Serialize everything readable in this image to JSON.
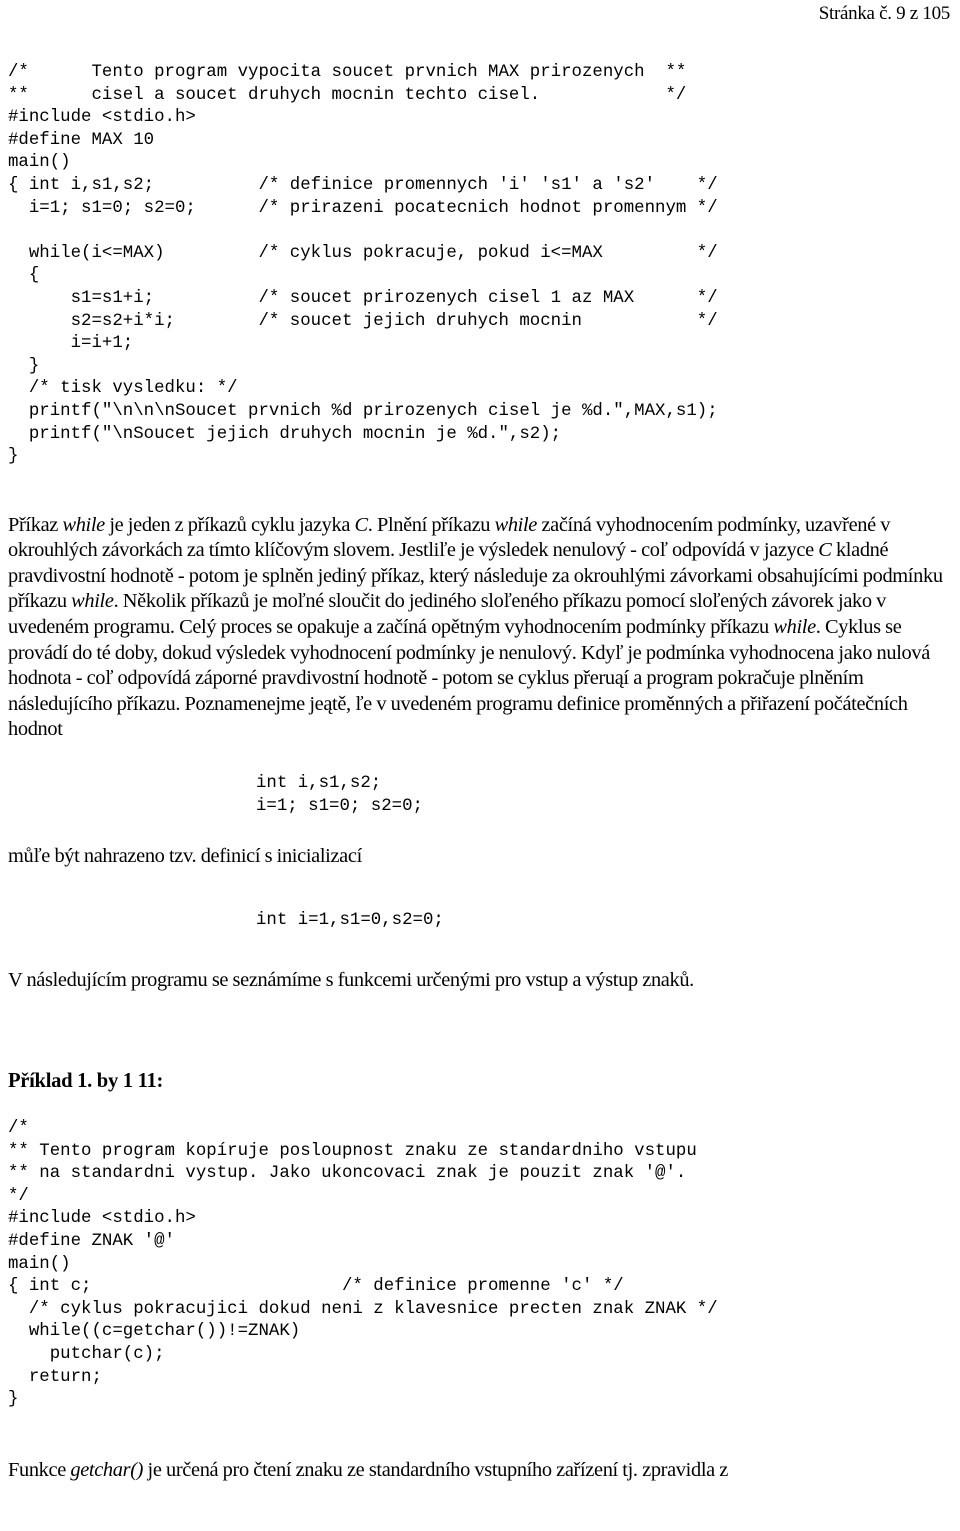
{
  "header": {
    "page_indicator": "Stránka č. 9 z 105"
  },
  "code_block_1": "/*      Tento program vypocita soucet prvnich MAX prirozenych  **\n**      cisel a soucet druhych mocnin techto cisel.            */\n#include <stdio.h>\n#define MAX 10\nmain()\n{ int i,s1,s2;          /* definice promennych 'i' 's1' a 's2'    */\n  i=1; s1=0; s2=0;      /* prirazeni pocatecnich hodnot promennym */\n\n  while(i<=MAX)         /* cyklus pokracuje, pokud i<=MAX         */\n  {\n      s1=s1+i;          /* soucet prirozenych cisel 1 az MAX      */\n      s2=s2+i*i;        /* soucet jejich druhych mocnin           */\n      i=i+1;\n  }\n  /* tisk vysledku: */\n  printf(\"\\n\\n\\nSoucet prvnich %d prirozenych cisel je %d.\",MAX,s1);\n  printf(\"\\nSoucet jejich druhych mocnin je %d.\",s2);\n}",
  "paragraph_1": {
    "parts": [
      {
        "text": "Příkaz ",
        "italic": false
      },
      {
        "text": "while",
        "italic": true
      },
      {
        "text": " je jeden z příkazů cyklu jazyka ",
        "italic": false
      },
      {
        "text": "C",
        "italic": true
      },
      {
        "text": ". Plnění příkazu ",
        "italic": false
      },
      {
        "text": "while",
        "italic": true
      },
      {
        "text": " začíná vyhodnocením podmínky, uzavřené v okrouhlých závorkách za tímto klíčovým slovem. Jestliľe je výsledek nenulový - coľ odpovídá v jazyce ",
        "italic": false
      },
      {
        "text": "C",
        "italic": true
      },
      {
        "text": " kladné pravdivostní hodnotě - potom je splněn jediný příkaz, který následuje za okrouhlými závorkami obsahujícími podmínku příkazu ",
        "italic": false
      },
      {
        "text": "while",
        "italic": true
      },
      {
        "text": ". Několik příkazů je moľné sloučit do jediného sloľeného příkazu pomocí sloľených závorek jako v uvedeném programu. Celý proces se opakuje a začíná opětným vyhodnocením podmínky příkazu ",
        "italic": false
      },
      {
        "text": "while",
        "italic": true
      },
      {
        "text": ". Cyklus se provádí do té doby, dokud výsledek vyhodnocení podmínky je nenulový. Kdyľ je podmínka vyhodnocena jako nulová hodnota - coľ odpovídá záporné pravdivostní hodnotě - potom se cyklus přeruąí a program pokračuje plněním následujícího příkazu. Poznamenejme jeątě, ľe v uvedeném programu definice proměnných a přiřazení počátečních hodnot",
        "italic": false
      }
    ]
  },
  "code_block_2": "int i,s1,s2;\ni=1; s1=0; s2=0;",
  "paragraph_2": "můľe být nahrazeno tzv. definicí s inicializací",
  "code_block_3": "int i=1,s1=0,s2=0;",
  "paragraph_3": "V následujícím programu se seznámíme s funkcemi určenými pro vstup a výstup znaků.",
  "heading_1": "Příklad 1. by 1 11:",
  "code_block_4": "/*\n** Tento program kopíruje posloupnost znaku ze standardniho vstupu\n** na standardni vystup. Jako ukoncovaci znak je pouzit znak '@'.\n*/\n#include <stdio.h>\n#define ZNAK '@'\nmain()\n{ int c;                        /* definice promenne 'c' */\n  /* cyklus pokracujici dokud neni z klavesnice precten znak ZNAK */\n  while((c=getchar())!=ZNAK)\n    putchar(c);\n  return;\n}",
  "paragraph_4": {
    "parts": [
      {
        "text": "Funkce ",
        "italic": false
      },
      {
        "text": "getchar()",
        "italic": true
      },
      {
        "text": " je určená pro čtení znaku ze standardního vstupního zařízení tj. zpravidla z",
        "italic": false
      }
    ]
  }
}
